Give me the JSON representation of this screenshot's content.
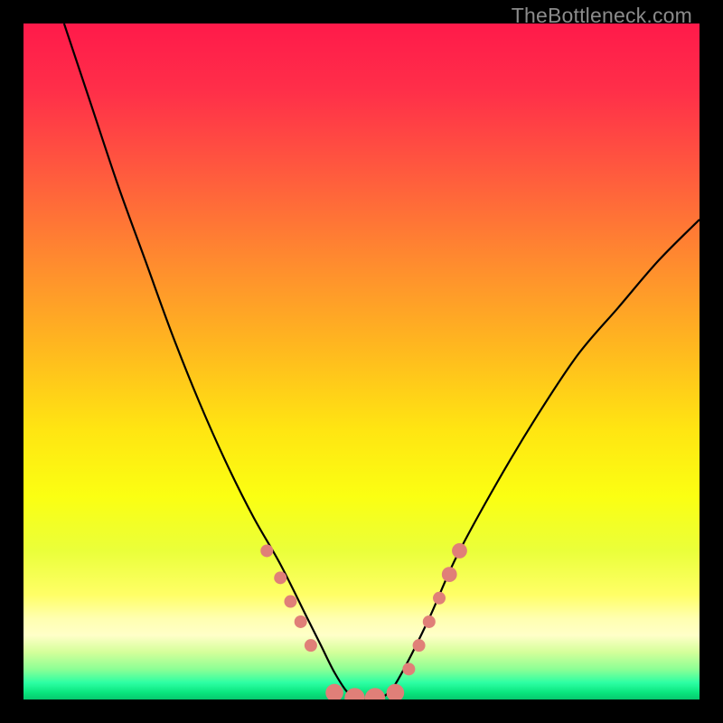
{
  "watermark": "TheBottleneck.com",
  "chart_data": {
    "type": "line",
    "title": "",
    "xlabel": "",
    "ylabel": "",
    "xlim": [
      0,
      100
    ],
    "ylim": [
      0,
      100
    ],
    "grid": false,
    "legend": false,
    "annotations": [],
    "series": [
      {
        "name": "bottleneck-curve",
        "x": [
          6,
          10,
          14,
          18,
          22,
          26,
          30,
          34,
          38,
          42,
          44,
          46,
          48,
          50,
          52,
          54,
          56,
          60,
          64,
          70,
          76,
          82,
          88,
          94,
          100
        ],
        "y": [
          100,
          88,
          76,
          65,
          54,
          44,
          35,
          27,
          20,
          12,
          8,
          4,
          1,
          0,
          0,
          1,
          4,
          12,
          21,
          32,
          42,
          51,
          58,
          65,
          71
        ]
      }
    ],
    "markers": [
      {
        "x": 36.0,
        "y": 22.0,
        "r": 1.0
      },
      {
        "x": 38.0,
        "y": 18.0,
        "r": 1.0
      },
      {
        "x": 39.5,
        "y": 14.5,
        "r": 1.0
      },
      {
        "x": 41.0,
        "y": 11.5,
        "r": 1.0
      },
      {
        "x": 42.5,
        "y": 8.0,
        "r": 1.0
      },
      {
        "x": 46.0,
        "y": 1.0,
        "r": 1.4
      },
      {
        "x": 49.0,
        "y": 0.2,
        "r": 1.6
      },
      {
        "x": 52.0,
        "y": 0.2,
        "r": 1.6
      },
      {
        "x": 55.0,
        "y": 1.0,
        "r": 1.4
      },
      {
        "x": 57.0,
        "y": 4.5,
        "r": 1.0
      },
      {
        "x": 58.5,
        "y": 8.0,
        "r": 1.0
      },
      {
        "x": 60.0,
        "y": 11.5,
        "r": 1.0
      },
      {
        "x": 61.5,
        "y": 15.0,
        "r": 1.0
      },
      {
        "x": 63.0,
        "y": 18.5,
        "r": 1.2
      },
      {
        "x": 64.5,
        "y": 22.0,
        "r": 1.2
      }
    ],
    "gradient_stops": [
      {
        "offset": 0.0,
        "color": "#ff1a4a"
      },
      {
        "offset": 0.1,
        "color": "#ff2f49"
      },
      {
        "offset": 0.22,
        "color": "#ff5a3e"
      },
      {
        "offset": 0.35,
        "color": "#ff8a2f"
      },
      {
        "offset": 0.48,
        "color": "#ffb81f"
      },
      {
        "offset": 0.6,
        "color": "#ffe512"
      },
      {
        "offset": 0.7,
        "color": "#fbff12"
      },
      {
        "offset": 0.78,
        "color": "#eaff3a"
      },
      {
        "offset": 0.845,
        "color": "#ffff66"
      },
      {
        "offset": 0.88,
        "color": "#ffffb0"
      },
      {
        "offset": 0.905,
        "color": "#ffffc8"
      },
      {
        "offset": 0.93,
        "color": "#d4ff9a"
      },
      {
        "offset": 0.955,
        "color": "#8dff95"
      },
      {
        "offset": 0.975,
        "color": "#2dffa4"
      },
      {
        "offset": 0.99,
        "color": "#09e57d"
      },
      {
        "offset": 1.0,
        "color": "#07c86e"
      }
    ],
    "marker_color": "#e07f78",
    "curve_color": "#000000"
  }
}
